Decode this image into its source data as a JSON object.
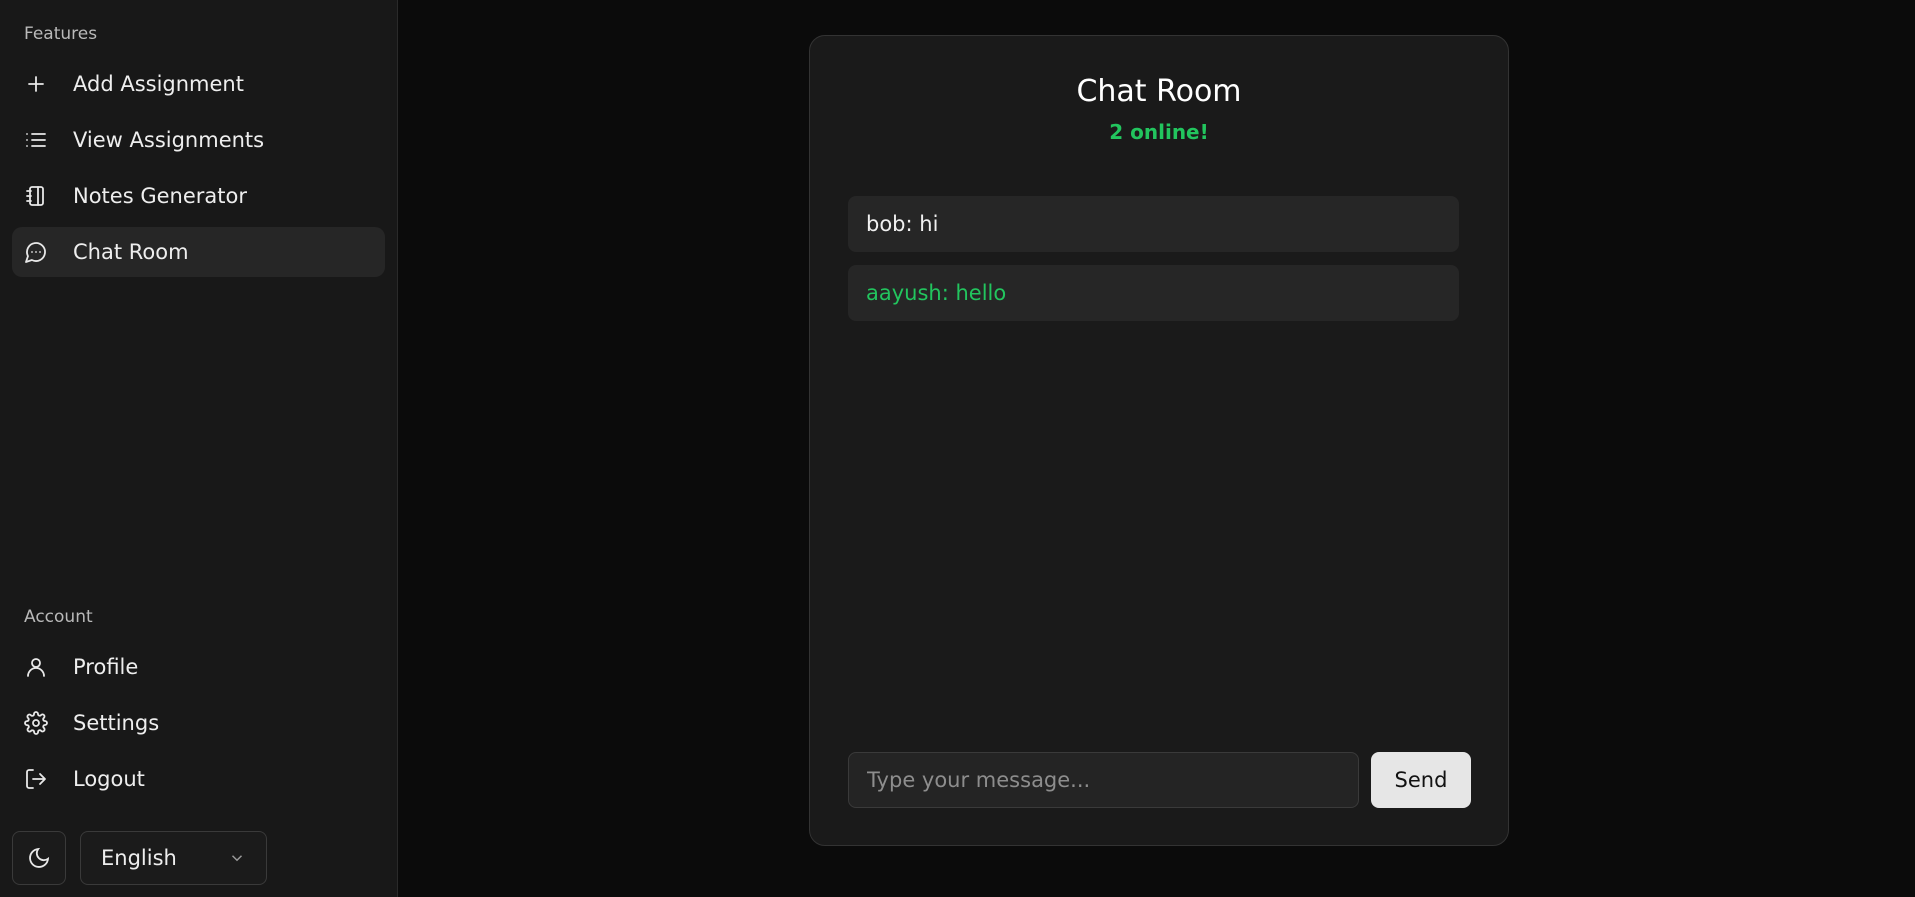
{
  "sidebar": {
    "features_label": "Features",
    "features": [
      {
        "label": "Add Assignment",
        "icon": "plus-icon"
      },
      {
        "label": "View Assignments",
        "icon": "list-icon"
      },
      {
        "label": "Notes Generator",
        "icon": "notebook-icon"
      },
      {
        "label": "Chat Room",
        "icon": "chat-icon",
        "active": true
      }
    ],
    "account_label": "Account",
    "account": [
      {
        "label": "Profile",
        "icon": "user-icon"
      },
      {
        "label": "Settings",
        "icon": "gear-icon"
      },
      {
        "label": "Logout",
        "icon": "logout-icon"
      }
    ],
    "theme_icon": "moon-icon",
    "language": "English"
  },
  "chat": {
    "title": "Chat Room",
    "online": "2 online!",
    "messages": [
      {
        "text": "bob: hi",
        "own": false
      },
      {
        "text": "aayush: hello",
        "own": true
      }
    ],
    "input_placeholder": "Type your message...",
    "send_label": "Send"
  },
  "colors": {
    "accent_green": "#22c55e",
    "background": "#0b0b0b",
    "sidebar_bg": "#181818",
    "card_bg": "#1a1a1a"
  }
}
